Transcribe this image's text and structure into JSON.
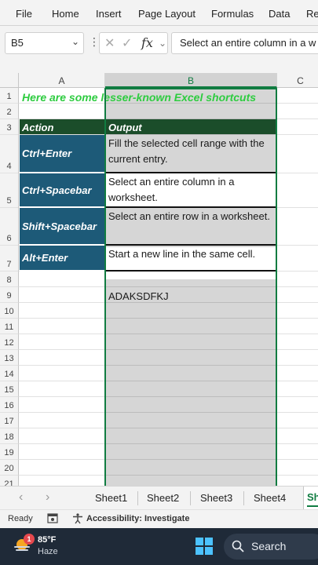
{
  "ribbon": {
    "tabs": [
      "File",
      "Home",
      "Insert",
      "Page Layout",
      "Formulas",
      "Data",
      "Re"
    ]
  },
  "formula_bar": {
    "name_box": "B5",
    "formula": "Select an entire column in a w",
    "fx": "fx"
  },
  "columns": [
    "A",
    "B",
    "C"
  ],
  "rows": [
    "1",
    "2",
    "3",
    "4",
    "5",
    "6",
    "7",
    "8",
    "9",
    "10",
    "11",
    "12",
    "13",
    "14",
    "15",
    "16",
    "17",
    "18",
    "19",
    "20",
    "21"
  ],
  "sheet": {
    "title": "Here are some lesser-known Excel shortcuts",
    "header_action": "Action",
    "header_output": "Output",
    "entries": [
      {
        "action": "Ctrl+Enter",
        "output": "Fill the selected cell range with the current entry."
      },
      {
        "action": "Ctrl+Spacebar",
        "output": "Select an entire column in a worksheet."
      },
      {
        "action": "Shift+Spacebar",
        "output": "Select an entire row in a worksheet."
      },
      {
        "action": "Alt+Enter",
        "output": "Start a new line in the same cell."
      }
    ],
    "b9": "ADAKSDFKJ"
  },
  "sheet_tabs": [
    "Sheet1",
    "Sheet2",
    "Sheet3",
    "Sheet4",
    "Sh"
  ],
  "status": {
    "ready": "Ready",
    "accessibility": "Accessibility: Investigate"
  },
  "taskbar": {
    "weather_badge": "1",
    "temperature": "85°F",
    "condition": "Haze",
    "search_label": "Search"
  },
  "colors": {
    "accent": "#107c41",
    "title_green": "#2ecc40",
    "header_dark_green": "#1b4d2a",
    "action_blue": "#1d5a78",
    "taskbar": "#1f2a38"
  }
}
